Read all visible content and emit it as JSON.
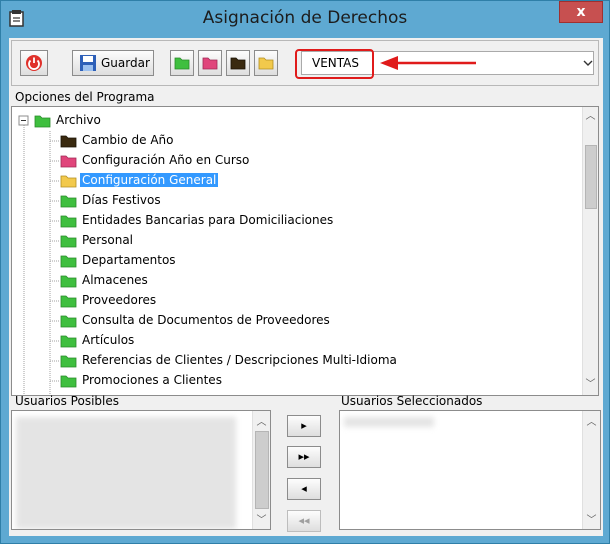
{
  "window": {
    "title": "Asignación de Derechos",
    "close_label": "x"
  },
  "toolbar": {
    "power_icon": "power-icon",
    "save_label": "Guardar",
    "folder_buttons": [
      {
        "icon": "folder-green-icon",
        "color": "#3fbf3f"
      },
      {
        "icon": "folder-red-icon",
        "color": "#e0457b"
      },
      {
        "icon": "folder-black-icon",
        "color": "#3a2a10"
      },
      {
        "icon": "folder-yellow-icon",
        "color": "#f2c94c"
      }
    ],
    "profile_value": "VENTAS"
  },
  "program_options": {
    "label": "Opciones del Programa",
    "root": "Archivo",
    "items": [
      {
        "label": "Cambio de Año",
        "icon": "folder-black-icon"
      },
      {
        "label": "Configuración Año en Curso",
        "icon": "folder-red-icon"
      },
      {
        "label": "Configuración General",
        "icon": "folder-yellow-icon",
        "selected": true
      },
      {
        "label": "Días Festivos",
        "icon": "folder-green-icon"
      },
      {
        "label": "Entidades Bancarias para Domiciliaciones",
        "icon": "folder-green-icon"
      },
      {
        "label": "Personal",
        "icon": "folder-green-icon"
      },
      {
        "label": "Departamentos",
        "icon": "folder-green-icon"
      },
      {
        "label": "Almacenes",
        "icon": "folder-green-icon"
      },
      {
        "label": "Proveedores",
        "icon": "folder-green-icon"
      },
      {
        "label": "Consulta de Documentos de Proveedores",
        "icon": "folder-green-icon"
      },
      {
        "label": "Artículos",
        "icon": "folder-green-icon"
      },
      {
        "label": "Referencias de Clientes / Descripciones Multi-Idioma",
        "icon": "folder-green-icon"
      },
      {
        "label": "Promociones a Clientes",
        "icon": "folder-green-icon"
      }
    ]
  },
  "users": {
    "possible_label": "Usuarios Posibles",
    "selected_label": "Usuarios Seleccionados",
    "move_buttons": [
      {
        "label": "▸",
        "name": "add-user-button"
      },
      {
        "label": "▸▸",
        "name": "add-all-users-button"
      },
      {
        "label": "◂",
        "name": "remove-user-button"
      },
      {
        "label": "◂◂",
        "name": "remove-all-users-button"
      }
    ]
  },
  "colors": {
    "titlebar": "#5ea9d2",
    "selection": "#3399ff",
    "annotation": "#e01b1b"
  }
}
